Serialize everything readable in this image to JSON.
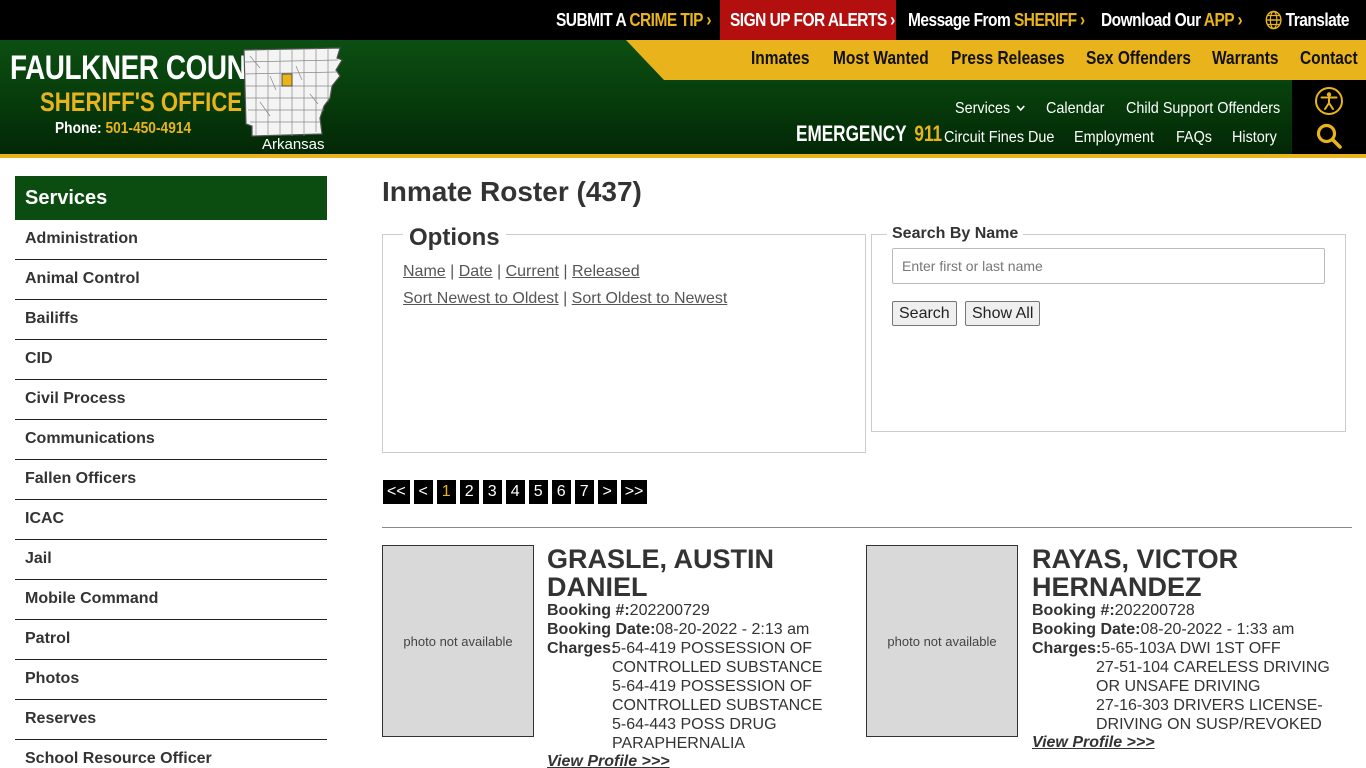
{
  "topbar": {
    "crime_tip_a": "SUBMIT A ",
    "crime_tip_b": "CRIME TIP",
    "alerts": "SIGN UP FOR ALERTS",
    "sheriff_a": "Message From ",
    "sheriff_b": "SHERIFF",
    "app_a": "Download Our ",
    "app_b": "APP",
    "translate": "Translate",
    "chevron": "›"
  },
  "brand": {
    "title": "FAULKNER COUNTY",
    "subtitle": "SHERIFF'S OFFICE",
    "phone_label": "Phone: ",
    "phone_number": "501-450-4914",
    "map_label": "Arkansas"
  },
  "main_nav": [
    "Inmates",
    "Most Wanted",
    "Press Releases",
    "Sex Offenders",
    "Warrants",
    "Contact"
  ],
  "sub_nav": {
    "services": "Services",
    "calendar": "Calendar",
    "child_support": "Child Support Offenders",
    "fines": "Circuit Fines Due",
    "employment": "Employment",
    "faqs": "FAQs",
    "history": "History"
  },
  "emergency": {
    "label": "EMERGENCY",
    "number": "911"
  },
  "sidebar": {
    "title": "Services",
    "items": [
      "Administration",
      "Animal Control",
      "Bailiffs",
      "CID",
      "Civil Process",
      "Communications",
      "Fallen Officers",
      "ICAC",
      "Jail",
      "Mobile Command",
      "Patrol",
      "Photos",
      "Reserves",
      "School Resource Officer"
    ]
  },
  "roster": {
    "title": "Inmate Roster (437)",
    "options_legend": "Options",
    "sort_by": [
      "Name",
      "Date",
      "Current",
      "Released"
    ],
    "sort_order": [
      "Sort Newest to Oldest",
      "Sort Oldest to Newest"
    ],
    "separator": " | ",
    "search_legend": "Search By Name",
    "search_placeholder": "Enter first or last name",
    "search_button": "Search",
    "show_all_button": "Show All"
  },
  "pagination": {
    "first": "<<",
    "prev": "<",
    "pages": [
      "1",
      "2",
      "3",
      "4",
      "5",
      "6",
      "7"
    ],
    "current": "1",
    "next": ">",
    "last": ">>"
  },
  "inmates": [
    {
      "name": "GRASLE, AUSTIN DANIEL",
      "photo": "photo not available",
      "booking_label": "Booking #:",
      "booking": "202200729",
      "date_label": "Booking Date:",
      "date": "08-20-2022 - 2:13 am",
      "charges_label": "Charges:",
      "charges": [
        "5-64-419 POSSESSION OF CONTROLLED SUBSTANCE",
        "5-64-419 POSSESSION OF CONTROLLED SUBSTANCE",
        "5-64-443 POSS DRUG PARAPHERNALIA"
      ],
      "view": "View Profile >>>"
    },
    {
      "name": "RAYAS, VICTOR HERNANDEZ",
      "photo": "photo not available",
      "booking_label": "Booking #:",
      "booking": "202200728",
      "date_label": "Booking Date:",
      "date": "08-20-2022 - 1:33 am",
      "charges_label": "Charges:",
      "charges": [
        "5-65-103A DWI 1ST OFF",
        "27-51-104 CARELESS DRIVING OR UNSAFE DRIVING",
        "27-16-303 DRIVERS LICENSE-DRIVING ON SUSP/REVOKED"
      ],
      "view": "View Profile >>>"
    }
  ],
  "colors": {
    "green": "#0b4d10",
    "gold": "#e9b41b",
    "alert_red": "#b30f0f",
    "black": "#000000"
  }
}
